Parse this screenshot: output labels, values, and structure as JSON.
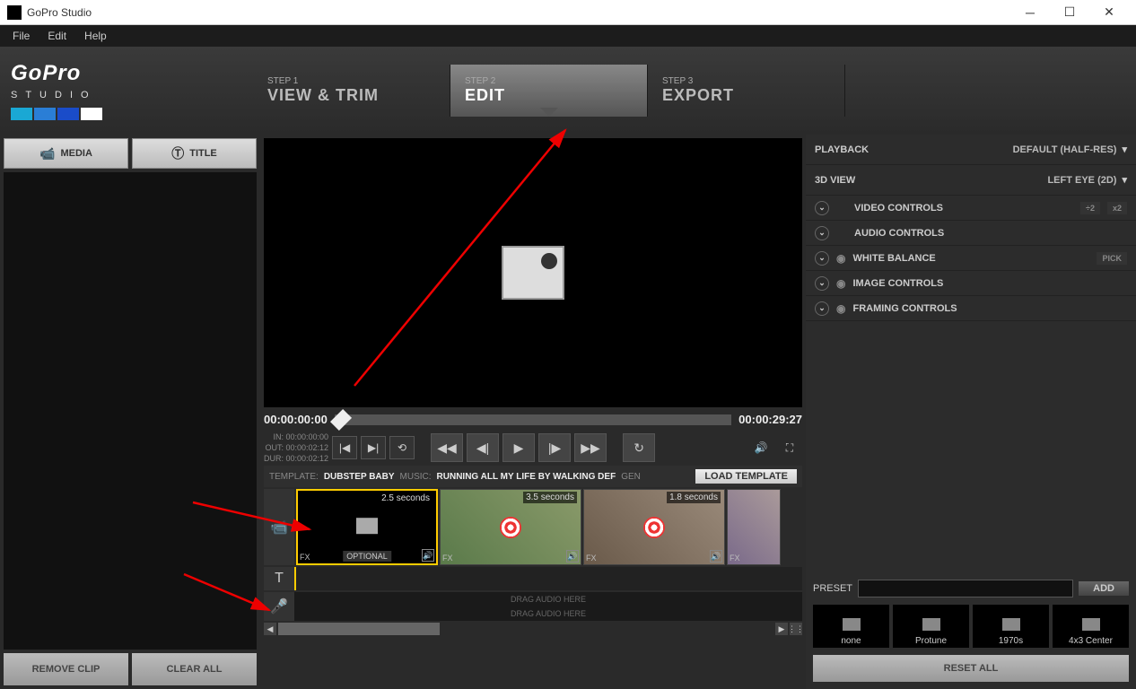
{
  "window": {
    "title": "GoPro Studio"
  },
  "menu": {
    "file": "File",
    "edit": "Edit",
    "help": "Help"
  },
  "logo": {
    "brand": "GoPro",
    "sub": "STUDIO"
  },
  "steps": [
    {
      "label": "STEP 1",
      "name": "VIEW & TRIM"
    },
    {
      "label": "STEP 2",
      "name": "EDIT"
    },
    {
      "label": "STEP 3",
      "name": "EXPORT"
    }
  ],
  "left": {
    "media": "MEDIA",
    "title": "TITLE",
    "remove": "REMOVE CLIP",
    "clear": "CLEAR ALL"
  },
  "player": {
    "current": "00:00:00:00",
    "total": "00:00:29:27",
    "in_label": "IN:",
    "in_val": "00:00:00:00",
    "out_label": "OUT:",
    "out_val": "00:00:02:12",
    "dur_label": "DUR:",
    "dur_val": "00:00:02:12"
  },
  "template": {
    "tpl_label": "TEMPLATE:",
    "tpl_val": "DUBSTEP BABY",
    "music_label": "MUSIC:",
    "music_val": "RUNNING ALL MY LIFE BY WALKING DEF",
    "gen_label": "GEN",
    "load": "LOAD TEMPLATE"
  },
  "clips": [
    {
      "dur": "2.5 seconds",
      "opt": "OPTIONAL"
    },
    {
      "dur": "3.5 seconds"
    },
    {
      "dur": "1.8 seconds"
    }
  ],
  "audio_placeholder": "DRAG AUDIO HERE",
  "fx_label": "FX",
  "right": {
    "playback_label": "PLAYBACK",
    "playback_value": "DEFAULT (HALF-RES)",
    "view3d_label": "3D VIEW",
    "view3d_value": "LEFT EYE (2D)",
    "controls": [
      {
        "name": "VIDEO CONTROLS",
        "extra1": "÷2",
        "extra2": "x2"
      },
      {
        "name": "AUDIO CONTROLS"
      },
      {
        "name": "WHITE BALANCE",
        "extra1": "PICK"
      },
      {
        "name": "IMAGE CONTROLS"
      },
      {
        "name": "FRAMING CONTROLS"
      }
    ],
    "preset_label": "PRESET",
    "preset_add": "ADD",
    "presets": [
      "none",
      "Protune",
      "1970s",
      "4x3 Center"
    ],
    "reset": "RESET ALL"
  }
}
